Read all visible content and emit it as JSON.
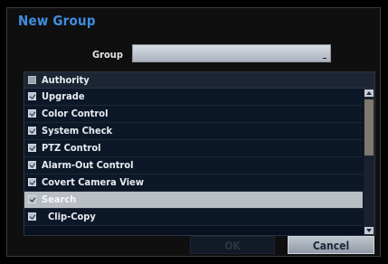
{
  "dialog": {
    "title": "New Group",
    "group_label": "Group",
    "group_value": ""
  },
  "list": {
    "header": {
      "label": "Authority",
      "checked": false
    },
    "items": [
      {
        "label": "Upgrade",
        "checked": true
      },
      {
        "label": "Color Control",
        "checked": true
      },
      {
        "label": "System Check",
        "checked": true
      },
      {
        "label": "PTZ Control",
        "checked": true
      },
      {
        "label": "Alarm-Out Control",
        "checked": true
      },
      {
        "label": "Covert Camera View",
        "checked": true
      },
      {
        "label": "Search",
        "checked": true,
        "selected": true
      },
      {
        "label": "Clip-Copy",
        "checked": true
      }
    ]
  },
  "buttons": {
    "ok_label": "OK",
    "ok_enabled": false,
    "cancel_label": "Cancel"
  },
  "colors": {
    "title": "#3f8ee0",
    "selected_row": "#b9bdc4"
  }
}
